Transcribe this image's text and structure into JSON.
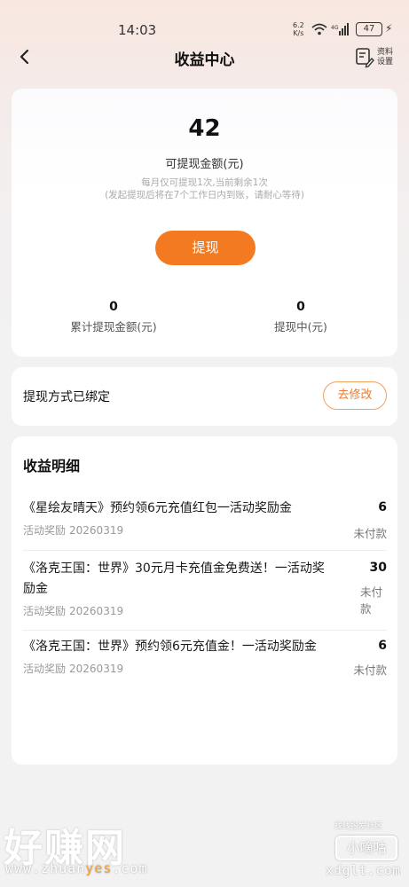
{
  "status_bar": {
    "time": "14:03",
    "net_speed_value": "6.2",
    "net_speed_unit": "K/s",
    "battery": "47"
  },
  "header": {
    "title": "收益中心",
    "settings_label": "资料设置"
  },
  "balance": {
    "amount": "42",
    "amount_label": "可提现金额(元)",
    "note_line1": "每月仅可提现1次,当前剩余1次",
    "note_line2": "(发起提现后将在7个工作日内到账，请耐心等待)",
    "withdraw_button": "提现",
    "total_withdrawn_value": "0",
    "total_withdrawn_label": "累计提现金额(元)",
    "pending_value": "0",
    "pending_label": "提现中(元)"
  },
  "method": {
    "label": "提现方式已绑定",
    "modify_button": "去修改"
  },
  "details": {
    "title": "收益明细",
    "entries": [
      {
        "title": "《星绘友晴天》预约领6元充值红包一活动奖励金",
        "type": "活动奖励",
        "date": "20260319",
        "amount": "6",
        "status": "未付款"
      },
      {
        "title": "《洛克王国：世界》30元月卡充值金免费送！一活动奖励金",
        "type": "活动奖励",
        "date": "20260319",
        "amount": "30",
        "status": "未付款"
      },
      {
        "title": "《洛克王国：世界》预约领6元充值金！一活动奖励金",
        "type": "活动奖励",
        "date": "20260319",
        "amount": "6",
        "status": "未付款"
      }
    ]
  },
  "watermark": {
    "left_big": "好赚网",
    "left_url_pre": "www.zhuan",
    "left_url_hl": "yes",
    "left_url_post": ".com",
    "right_top": "找线报发社区",
    "right_box": "小嘀咕",
    "right_url": "xdglt.com"
  },
  "colors": {
    "accent": "#f47a22",
    "accent_border": "#f0a05c"
  }
}
